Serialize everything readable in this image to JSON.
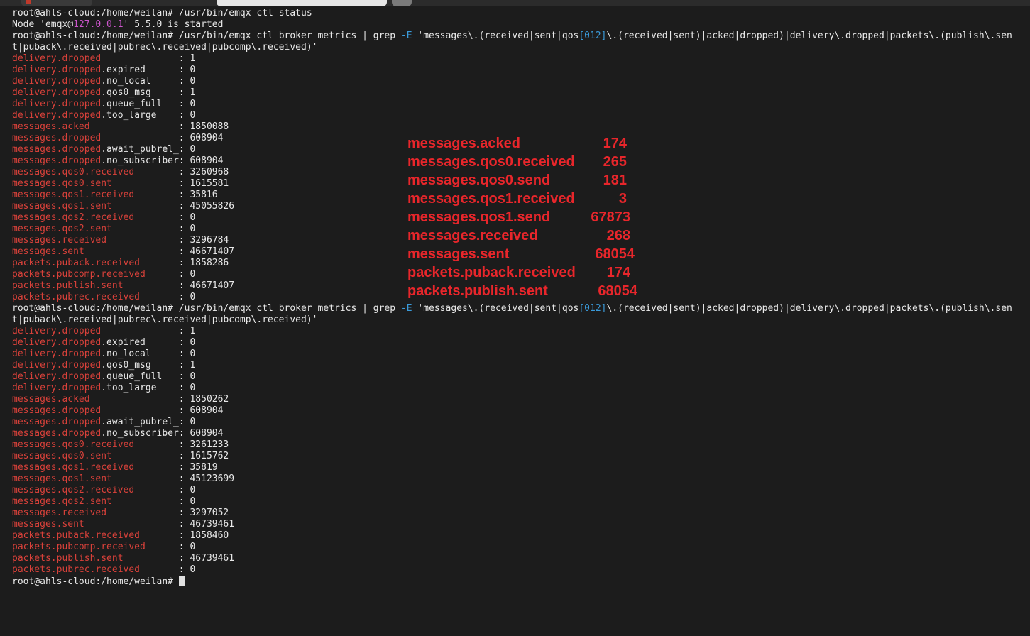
{
  "terminal": {
    "prompt": "root@ahls-cloud:/home/weilan#",
    "cmd_status": " /usr/bin/emqx ctl status",
    "status_line": {
      "pre": "Node 'emqx@",
      "ip": "127.0.0.1",
      "post": "' 5.5.0 is started"
    },
    "grep_cmd": {
      "a": " /usr/bin/emqx ctl broker metrics | grep ",
      "flag": "-E",
      "b": " 'messages\\.(received|sent|qos",
      "cls": "[012]",
      "c": "\\.(received|sent)|acked|dropped)|delivery\\.dropped|packets\\.(publish\\.sen",
      "d": "t|puback\\.received|pubrec\\.received|pubcomp\\.received)'"
    },
    "metric_names": [
      "delivery.dropped",
      "delivery.dropped.expired",
      "delivery.dropped.no_local",
      "delivery.dropped.qos0_msg",
      "delivery.dropped.queue_full",
      "delivery.dropped.too_large",
      "messages.acked",
      "messages.dropped",
      "messages.dropped.await_pubrel_",
      "messages.dropped.no_subscriber",
      "messages.qos0.received",
      "messages.qos0.sent",
      "messages.qos1.received",
      "messages.qos1.sent",
      "messages.qos2.received",
      "messages.qos2.sent",
      "messages.received",
      "messages.sent",
      "packets.puback.received",
      "packets.pubcomp.received",
      "packets.publish.sent",
      "packets.pubrec.received"
    ],
    "run1_values": [
      "1",
      "0",
      "0",
      "1",
      "0",
      "0",
      "1850088",
      "608904",
      "0",
      "608904",
      "3260968",
      "1615581",
      "35816",
      "45055826",
      "0",
      "0",
      "3296784",
      "46671407",
      "1858286",
      "0",
      "46671407",
      "0"
    ],
    "run2_values": [
      "1",
      "0",
      "0",
      "1",
      "0",
      "0",
      "1850262",
      "608904",
      "0",
      "608904",
      "3261233",
      "1615762",
      "35819",
      "45123699",
      "0",
      "0",
      "3297052",
      "46739461",
      "1858460",
      "0",
      "46739461",
      "0"
    ]
  },
  "overlay": [
    {
      "name": "messages.acked",
      "value": "174"
    },
    {
      "name": "messages.qos0.received",
      "value": "265"
    },
    {
      "name": "messages.qos0.send",
      "value": "181"
    },
    {
      "name": "messages.qos1.received",
      "value": "3"
    },
    {
      "name": "messages.qos1.send",
      "value": "67873"
    },
    {
      "name": "messages.received",
      "value": "268"
    },
    {
      "name": "messages.sent",
      "value": "68054"
    },
    {
      "name": "packets.puback.received",
      "value": "174"
    },
    {
      "name": "packets.publish.sent",
      "value": "68054"
    }
  ],
  "colors": {
    "background": "#1c1c1c",
    "metric_name": "#d9413a",
    "overlay_text": "#e8262b",
    "ip_highlight": "#cc55cc",
    "grep_highlight": "#3a9ad9"
  }
}
